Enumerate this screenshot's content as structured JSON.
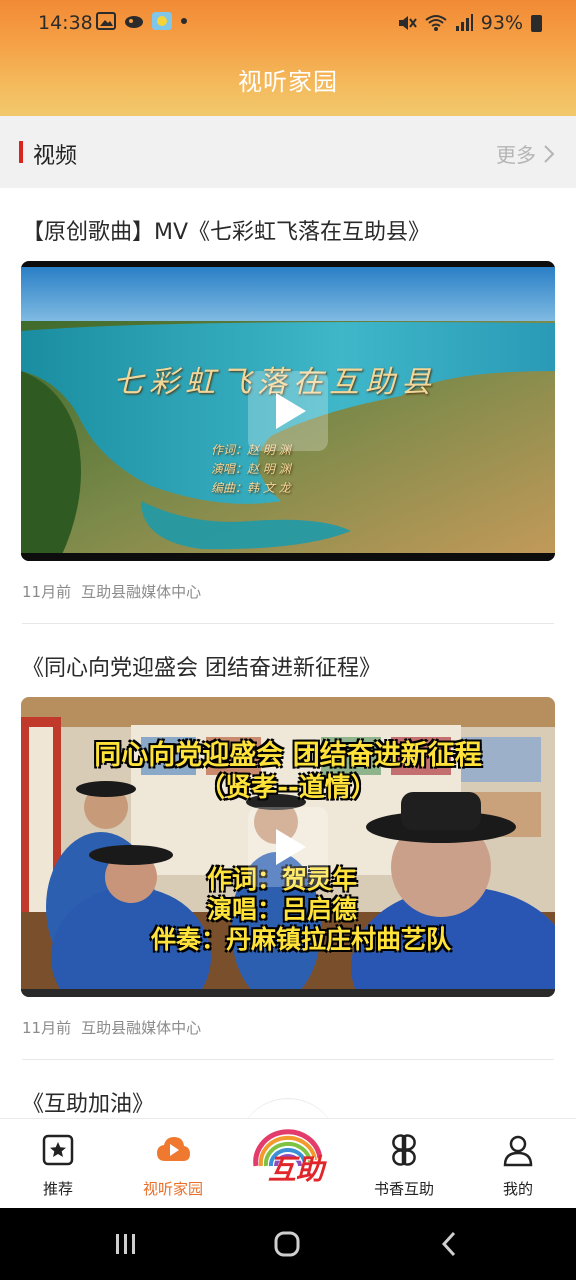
{
  "status": {
    "time": "14:38",
    "battery": "93%"
  },
  "header": {
    "title": "视听家园"
  },
  "section": {
    "title": "视频",
    "more_label": "更多"
  },
  "videos": [
    {
      "title": "【原创歌曲】MV《七彩虹飞落在互助县》",
      "time_ago": "11月前",
      "source": "互助县融媒体中心",
      "overlay_title": "七彩虹飞落在互助县",
      "overlay_credits": [
        "作词：赵 明 渊",
        "演唱：赵 明 渊",
        "编曲：韩 文 龙"
      ]
    },
    {
      "title": "《同心向党迎盛会  团结奋进新征程》",
      "time_ago": "11月前",
      "source": "互助县融媒体中心",
      "overlay_title": "同心向党迎盛会 团结奋进新征程",
      "overlay_subtitle": "（贤孝--道情）",
      "overlay_credits": [
        "作词：贺灵年",
        "演唱：吕启德",
        "伴奏：丹麻镇拉庄村曲艺队"
      ]
    },
    {
      "title": "《互助加油》"
    }
  ],
  "bottom_nav": {
    "items": [
      {
        "label": "推荐",
        "icon": "star-box-icon"
      },
      {
        "label": "视听家园",
        "icon": "cloud-play-icon",
        "active": true
      },
      {
        "label": "互助",
        "icon": "huzhu-logo"
      },
      {
        "label": "书香互助",
        "icon": "four-petal-icon"
      },
      {
        "label": "我的",
        "icon": "user-icon"
      }
    ]
  },
  "colors": {
    "accent": "#e8702a",
    "section_bar": "#d9261c",
    "header_top": "#f28a35",
    "header_bottom": "#f1c96c"
  }
}
